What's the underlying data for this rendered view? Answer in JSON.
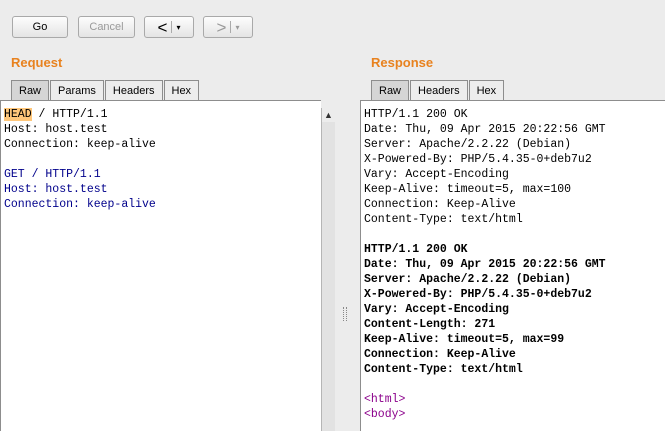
{
  "toolbar": {
    "go_label": "Go",
    "cancel_label": "Cancel",
    "back_glyph": "<",
    "back_caret": "▾",
    "forward_glyph": ">",
    "forward_caret": "▾"
  },
  "request": {
    "title": "Request",
    "tabs": [
      "Raw",
      "Params",
      "Headers",
      "Hex"
    ],
    "active_tab": "Raw",
    "lines": [
      {
        "parts": [
          {
            "t": "HEAD",
            "cls": "hl"
          },
          {
            "t": " / HTTP/1.1",
            "cls": ""
          }
        ]
      },
      {
        "parts": [
          {
            "t": "Host: host.test",
            "cls": ""
          }
        ]
      },
      {
        "parts": [
          {
            "t": "Connection: keep-alive",
            "cls": ""
          }
        ]
      },
      {
        "parts": []
      },
      {
        "parts": [
          {
            "t": "GET / HTTP/1.1",
            "cls": "blue"
          }
        ]
      },
      {
        "parts": [
          {
            "t": "Host: host.test",
            "cls": "blue"
          }
        ]
      },
      {
        "parts": [
          {
            "t": "Connection: keep-alive",
            "cls": "blue"
          }
        ]
      }
    ],
    "scroll_up_icon": "▲"
  },
  "response": {
    "title": "Response",
    "tabs": [
      "Raw",
      "Headers",
      "Hex"
    ],
    "active_tab": "Raw",
    "lines": [
      {
        "parts": [
          {
            "t": "HTTP/1.1 200 OK",
            "cls": ""
          }
        ]
      },
      {
        "parts": [
          {
            "t": "Date: Thu, 09 Apr 2015 20:22:56 GMT",
            "cls": ""
          }
        ]
      },
      {
        "parts": [
          {
            "t": "Server: Apache/2.2.22 (Debian)",
            "cls": ""
          }
        ]
      },
      {
        "parts": [
          {
            "t": "X-Powered-By: PHP/5.4.35-0+deb7u2",
            "cls": ""
          }
        ]
      },
      {
        "parts": [
          {
            "t": "Vary: Accept-Encoding",
            "cls": ""
          }
        ]
      },
      {
        "parts": [
          {
            "t": "Keep-Alive: timeout=5, max=100",
            "cls": ""
          }
        ]
      },
      {
        "parts": [
          {
            "t": "Connection: Keep-Alive",
            "cls": ""
          }
        ]
      },
      {
        "parts": [
          {
            "t": "Content-Type: text/html",
            "cls": ""
          }
        ]
      },
      {
        "parts": []
      },
      {
        "parts": [
          {
            "t": "HTTP/1.1 200 OK",
            "cls": "bold"
          }
        ]
      },
      {
        "parts": [
          {
            "t": "Date: Thu, 09 Apr 2015 20:22:56 GMT",
            "cls": "bold"
          }
        ]
      },
      {
        "parts": [
          {
            "t": "Server: Apache/2.2.22 (Debian)",
            "cls": "bold"
          }
        ]
      },
      {
        "parts": [
          {
            "t": "X-Powered-By: PHP/5.4.35-0+deb7u2",
            "cls": "bold"
          }
        ]
      },
      {
        "parts": [
          {
            "t": "Vary: Accept-Encoding",
            "cls": "bold"
          }
        ]
      },
      {
        "parts": [
          {
            "t": "Content-Length: 271",
            "cls": "bold"
          }
        ]
      },
      {
        "parts": [
          {
            "t": "Keep-Alive: timeout=5, max=99",
            "cls": "bold"
          }
        ]
      },
      {
        "parts": [
          {
            "t": "Connection: Keep-Alive",
            "cls": "bold"
          }
        ]
      },
      {
        "parts": [
          {
            "t": "Content-Type: text/html",
            "cls": "bold"
          }
        ]
      },
      {
        "parts": []
      },
      {
        "parts": [
          {
            "t": "<html>",
            "cls": "purple"
          }
        ]
      },
      {
        "parts": [
          {
            "t": "<body>",
            "cls": "purple"
          }
        ]
      }
    ]
  },
  "colors": {
    "section_title": "#e8821f",
    "highlight": "#ffc77a",
    "second_request_text": "#00008b",
    "html_tag_text": "#8b008b"
  },
  "icons": {
    "back": "chevron-left-icon",
    "forward": "chevron-right-icon",
    "dropdown": "caret-down-icon",
    "scroll_up": "arrow-up-icon",
    "divider_grip": "drag-handle-icon"
  }
}
